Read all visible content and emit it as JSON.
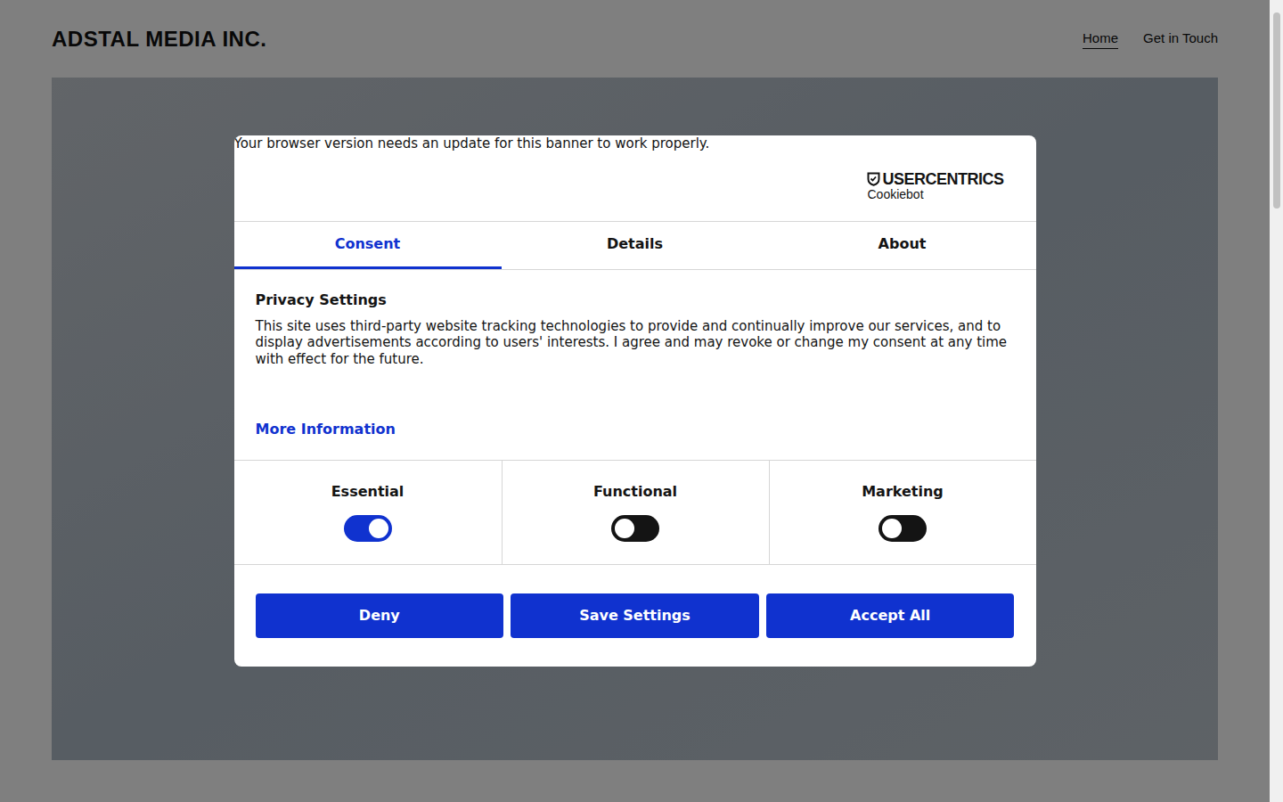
{
  "site": {
    "title": "ADSTAL MEDIA INC.",
    "nav": [
      {
        "label": "Home",
        "selected": true
      },
      {
        "label": "Get in Touch",
        "selected": false
      }
    ]
  },
  "dialog": {
    "notice": "Your browser version needs an update for this banner to work properly.",
    "logo": {
      "brand": "USERCENTRICS",
      "product": "Cookiebot"
    },
    "tabs": [
      {
        "label": "Consent",
        "selected": true
      },
      {
        "label": "Details",
        "selected": false
      },
      {
        "label": "About",
        "selected": false
      }
    ],
    "heading": "Privacy Settings",
    "body": "This site uses third-party website tracking technologies to provide and continually improve our services, and to display advertisements according to users' interests. I agree and may revoke or change my consent at any time with effect for the future.",
    "link": "More Information",
    "categories": [
      {
        "label": "Essential",
        "on": true
      },
      {
        "label": "Functional",
        "on": false
      },
      {
        "label": "Marketing",
        "on": false
      }
    ],
    "buttons": [
      "Deny",
      "Save Settings",
      "Accept All"
    ]
  }
}
